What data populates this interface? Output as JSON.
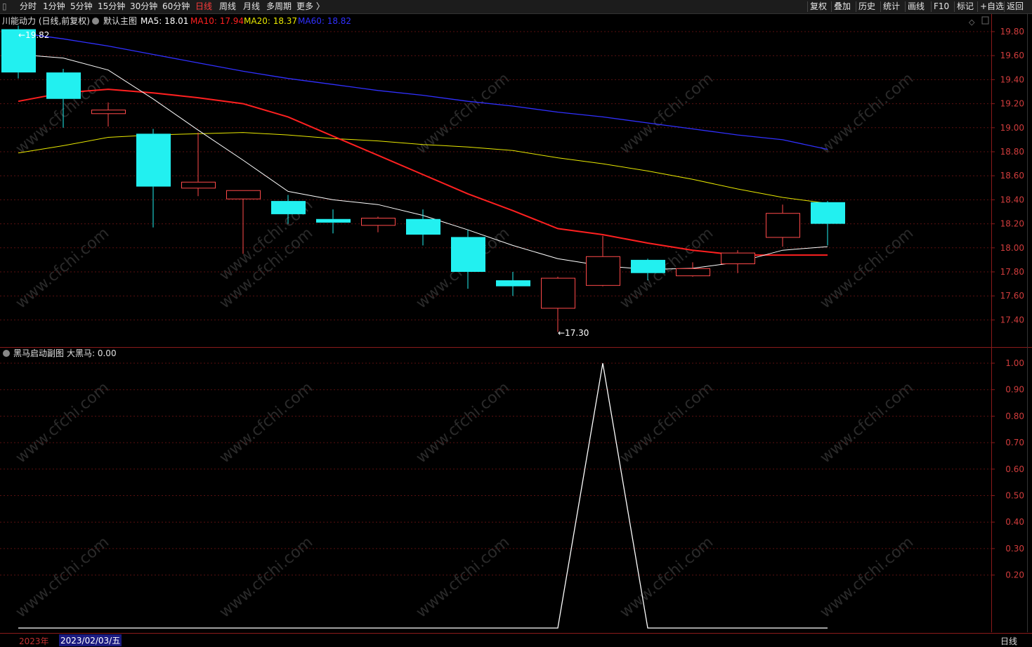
{
  "toolbar": {
    "left": [
      {
        "key": "min",
        "label": "分时"
      },
      {
        "key": "m1",
        "label": "1分钟"
      },
      {
        "key": "m5",
        "label": "5分钟"
      },
      {
        "key": "m15",
        "label": "15分钟"
      },
      {
        "key": "m30",
        "label": "30分钟"
      },
      {
        "key": "m60",
        "label": "60分钟"
      },
      {
        "key": "day",
        "label": "日线",
        "active": true
      },
      {
        "key": "week",
        "label": "周线"
      },
      {
        "key": "month",
        "label": "月线"
      },
      {
        "key": "multi",
        "label": "多周期"
      },
      {
        "key": "more",
        "label": "更多 〉"
      }
    ],
    "right": [
      {
        "key": "fuquan",
        "label": "复权"
      },
      {
        "key": "diejia",
        "label": "叠加"
      },
      {
        "key": "lishi",
        "label": "历史"
      },
      {
        "key": "tongji",
        "label": "统计"
      },
      {
        "key": "huaxian",
        "label": "画线"
      },
      {
        "key": "f10",
        "label": "F10"
      },
      {
        "key": "biaoji",
        "label": "标记"
      },
      {
        "key": "zixuan",
        "label": "+自选"
      },
      {
        "key": "fanhui",
        "label": "返回"
      }
    ]
  },
  "main_header": {
    "stock": "川能动力 (日线,前复权)",
    "indicator": "默认主图",
    "ma5": "MA5: 18.01",
    "ma10": "MA10: 17.94",
    "ma20": "MA20: 18.37",
    "ma60": "MA60: 18.82"
  },
  "sub_header": {
    "indicator": "黑马启动副图",
    "value": "大黑马: 0.00"
  },
  "annotations": {
    "high": "19.82",
    "low": "17.30"
  },
  "bottom": {
    "year": "2023年",
    "date": "2023/02/03/五",
    "period": "日线"
  },
  "watermark": "www.cfchi.com",
  "colors": {
    "up": "#ff4a4a",
    "down": "#22f0f0",
    "ma5": "#ffffff",
    "ma10": "#ff2020",
    "ma20": "#e8e800",
    "ma60": "#3030ff",
    "grid": "#5a1010",
    "axis_border": "#8b1a1a",
    "axis_text": "#d03c3c"
  },
  "chart_data": [
    {
      "type": "candlestick",
      "title": "默认主图",
      "ylim": [
        17.2,
        19.9
      ],
      "yticks": [
        "19.80",
        "19.60",
        "19.40",
        "19.20",
        "19.00",
        "18.80",
        "18.60",
        "18.40",
        "18.20",
        "18.00",
        "17.80",
        "17.60",
        "17.40"
      ],
      "candles": [
        {
          "o": 19.82,
          "h": 19.85,
          "l": 19.41,
          "c": 19.46
        },
        {
          "o": 19.46,
          "h": 19.49,
          "l": 19.0,
          "c": 19.24
        },
        {
          "o": 19.12,
          "h": 19.21,
          "l": 19.01,
          "c": 19.15
        },
        {
          "o": 18.95,
          "h": 18.99,
          "l": 18.17,
          "c": 18.51
        },
        {
          "o": 18.5,
          "h": 18.96,
          "l": 18.43,
          "c": 18.55
        },
        {
          "o": 18.41,
          "h": 18.48,
          "l": 17.95,
          "c": 18.48
        },
        {
          "o": 18.39,
          "h": 18.44,
          "l": 18.2,
          "c": 18.28
        },
        {
          "o": 18.24,
          "h": 18.32,
          "l": 18.12,
          "c": 18.21
        },
        {
          "o": 18.19,
          "h": 18.26,
          "l": 18.13,
          "c": 18.25
        },
        {
          "o": 18.24,
          "h": 18.32,
          "l": 18.02,
          "c": 18.11
        },
        {
          "o": 18.09,
          "h": 18.15,
          "l": 17.66,
          "c": 17.8
        },
        {
          "o": 17.73,
          "h": 17.8,
          "l": 17.6,
          "c": 17.68
        },
        {
          "o": 17.5,
          "h": 17.76,
          "l": 17.3,
          "c": 17.75
        },
        {
          "o": 17.69,
          "h": 18.1,
          "l": 17.68,
          "c": 17.93
        },
        {
          "o": 17.9,
          "h": 17.91,
          "l": 17.73,
          "c": 17.79
        },
        {
          "o": 17.77,
          "h": 17.88,
          "l": 17.76,
          "c": 17.83
        },
        {
          "o": 17.87,
          "h": 17.98,
          "l": 17.79,
          "c": 17.96
        },
        {
          "o": 18.09,
          "h": 18.36,
          "l": 18.01,
          "c": 18.29
        },
        {
          "o": 18.38,
          "h": 18.39,
          "l": 18.02,
          "c": 18.2
        }
      ],
      "ma5": [
        19.61,
        19.58,
        19.48,
        19.24,
        18.98,
        18.73,
        18.47,
        18.4,
        18.36,
        18.27,
        18.15,
        18.02,
        17.91,
        17.85,
        17.82,
        17.83,
        17.88,
        17.98,
        18.01
      ],
      "ma10": [
        19.22,
        19.29,
        19.32,
        19.29,
        19.25,
        19.2,
        19.09,
        18.93,
        18.77,
        18.61,
        18.45,
        18.31,
        18.16,
        18.11,
        18.04,
        17.98,
        17.94,
        17.94,
        17.94
      ],
      "ma20": [
        18.79,
        18.85,
        18.92,
        18.94,
        18.95,
        18.96,
        18.94,
        18.91,
        18.89,
        18.86,
        18.84,
        18.81,
        18.75,
        18.7,
        18.64,
        18.57,
        18.49,
        18.42,
        18.37
      ],
      "ma60": [
        19.79,
        19.74,
        19.68,
        19.61,
        19.54,
        19.47,
        19.41,
        19.36,
        19.31,
        19.27,
        19.22,
        19.18,
        19.13,
        19.09,
        19.04,
        18.99,
        18.94,
        18.9,
        18.82
      ]
    },
    {
      "type": "line",
      "title": "黑马启动副图",
      "series_name": "大黑马",
      "ylim": [
        0,
        1.0
      ],
      "yticks": [
        "1.00",
        "0.90",
        "0.80",
        "0.70",
        "0.60",
        "0.50",
        "0.40",
        "0.30",
        "0.20"
      ],
      "x_start_index": 0,
      "values": [
        0,
        0,
        0,
        0,
        0,
        0,
        0,
        0,
        0,
        0,
        0,
        0,
        0,
        1,
        0,
        0,
        0,
        0,
        0
      ]
    }
  ]
}
